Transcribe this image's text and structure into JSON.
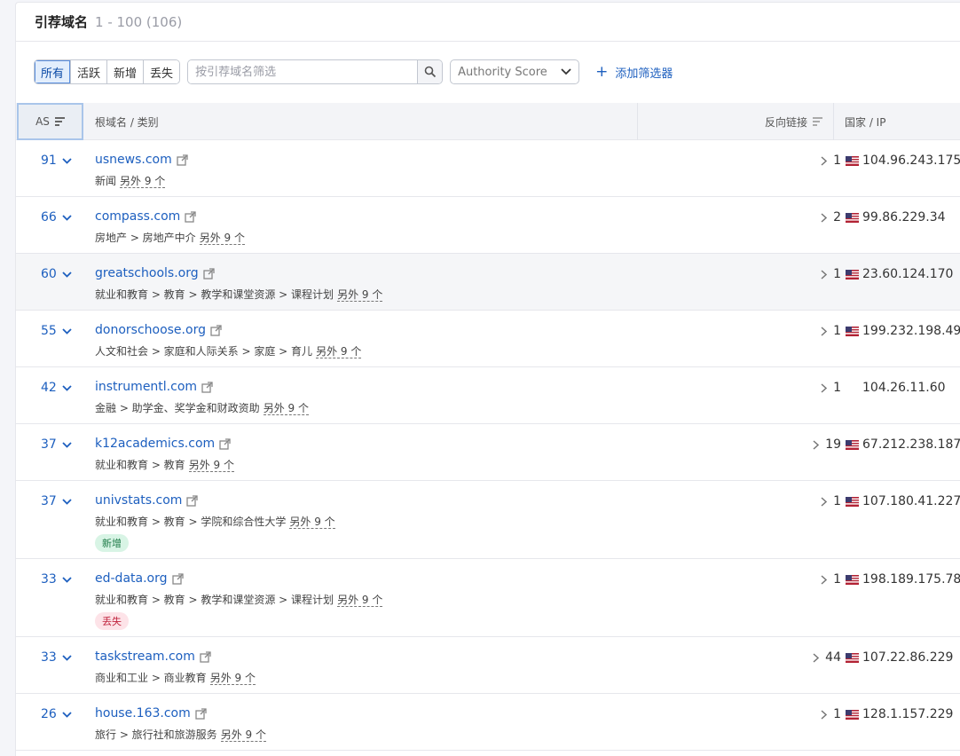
{
  "header": {
    "title": "引荐域名",
    "range": "1 - 100 (106)"
  },
  "toolbar": {
    "segments": [
      "所有",
      "活跃",
      "新增",
      "丢失"
    ],
    "search_placeholder": "按引荐域名筛选",
    "dropdown_label": "Authority Score",
    "add_filter_label": "添加筛选器"
  },
  "table": {
    "col_as": "AS",
    "col_domain": "根域名 / 类别",
    "col_links": "反向链接",
    "col_country": "国家 / IP"
  },
  "rows": [
    {
      "as": "91",
      "domain": "usnews.com",
      "cats": "新闻",
      "more": "另外 9 个",
      "links": "1",
      "ip": "104.96.243.175",
      "flag": true
    },
    {
      "as": "66",
      "domain": "compass.com",
      "cats": "房地产 > 房地产中介",
      "more": "另外 9 个",
      "links": "2",
      "ip": "99.86.229.34",
      "flag": true
    },
    {
      "as": "60",
      "domain": "greatschools.org",
      "cats": "就业和教育 > 教育 > 教学和课堂资源 > 课程计划",
      "more": "另外 9 个",
      "links": "1",
      "ip": "23.60.124.170",
      "flag": true
    },
    {
      "as": "55",
      "domain": "donorschoose.org",
      "cats": "人文和社会 > 家庭和人际关系 > 家庭 > 育儿",
      "more": "另外 9 个",
      "links": "1",
      "ip": "199.232.198.49",
      "flag": true
    },
    {
      "as": "42",
      "domain": "instrumentl.com",
      "cats": "金融 > 助学金、奖学金和财政资助",
      "more": "另外 9 个",
      "links": "1",
      "ip": "104.26.11.60",
      "flag": false
    },
    {
      "as": "37",
      "domain": "k12academics.com",
      "cats": "就业和教育 > 教育",
      "more": "另外 9 个",
      "links": "19",
      "ip": "67.212.238.187",
      "flag": true
    },
    {
      "as": "37",
      "domain": "univstats.com",
      "cats": "就业和教育 > 教育 > 学院和综合性大学",
      "more": "另外 9 个",
      "links": "1",
      "ip": "107.180.41.227",
      "flag": true,
      "badge": "新增",
      "badge_type": "new"
    },
    {
      "as": "33",
      "domain": "ed-data.org",
      "cats": "就业和教育 > 教育 > 教学和课堂资源 > 课程计划",
      "more": "另外 9 个",
      "links": "1",
      "ip": "198.189.175.78",
      "flag": true,
      "badge": "丢失",
      "badge_type": "lost"
    },
    {
      "as": "33",
      "domain": "taskstream.com",
      "cats": "商业和工业 > 商业教育",
      "more": "另外 9 个",
      "links": "44",
      "ip": "107.22.86.229",
      "flag": true
    },
    {
      "as": "26",
      "domain": "house.163.com",
      "cats": "旅行 > 旅行社和旅游服务",
      "more": "另外 9 个",
      "links": "1",
      "ip": "128.1.157.229",
      "flag": true
    }
  ]
}
